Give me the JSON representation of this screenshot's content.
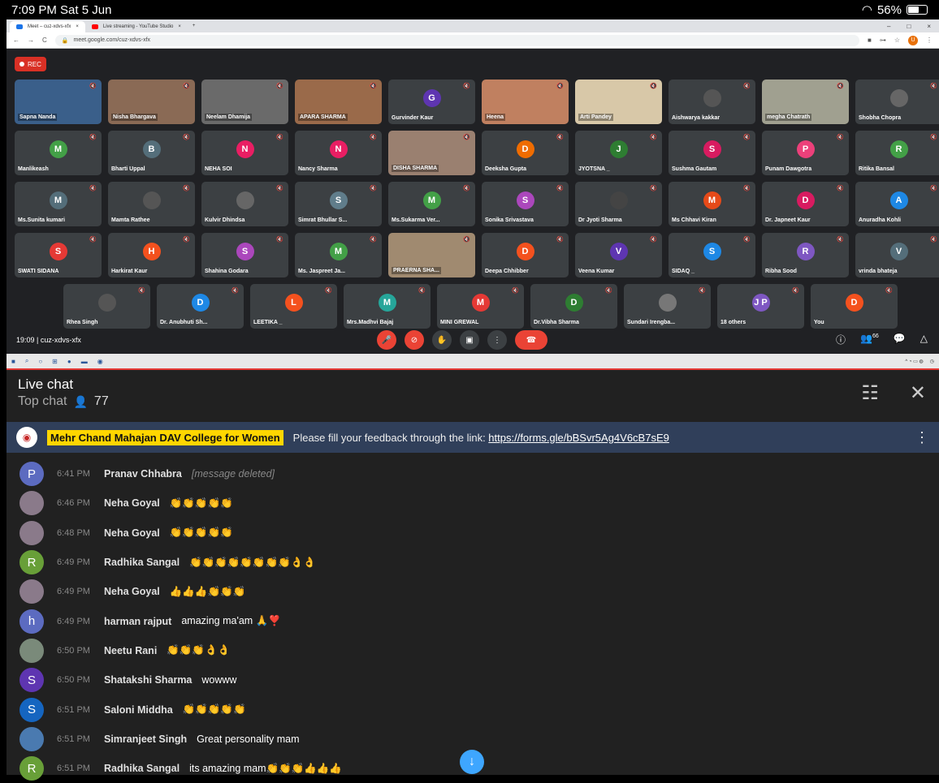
{
  "status": {
    "time": "7:09 PM  Sat 5 Jun",
    "battery": "56%",
    "battery_level": 0.56,
    "wifi_icon": "wifi-icon"
  },
  "browser": {
    "tabs": [
      {
        "label": "Meet – cuz-xdvs-xfx",
        "color": "#1a73e8"
      },
      {
        "label": "Live streaming - YouTube Studio",
        "color": "#ff0000"
      }
    ],
    "url": "meet.google.com/cuz-xdvs-xfx",
    "profile_initial": "U"
  },
  "meet": {
    "rec_label": "REC",
    "rows": [
      [
        {
          "name": "Sapna Nanda",
          "video": true,
          "bg": "#3a5f8a"
        },
        {
          "name": "Nisha Bhargava",
          "video": true,
          "bg": "#8a6a55"
        },
        {
          "name": "Neelam Dhamija",
          "video": true,
          "bg": "#6a6a6a"
        },
        {
          "name": "APARA SHARMA",
          "video": true,
          "bg": "#9a6a4a"
        },
        {
          "name": "Gurvinder Kaur",
          "initial": "G",
          "color": "#5e35b1"
        },
        {
          "name": "Heena",
          "video": true,
          "bg": "#c08060"
        },
        {
          "name": "Arti Pandey",
          "video": true,
          "bg": "#d8c8a8"
        },
        {
          "name": "Aishwarya kakkar",
          "initial": "",
          "color": "#555"
        },
        {
          "name": "megha Chatrath",
          "video": true,
          "bg": "#a0a090"
        },
        {
          "name": "Shobha Chopra",
          "initial": "",
          "color": "#666"
        }
      ],
      [
        {
          "name": "Manlikeash",
          "initial": "M",
          "color": "#43a047"
        },
        {
          "name": "Bharti Uppal",
          "initial": "B",
          "color": "#546e7a"
        },
        {
          "name": "NEHA SOI",
          "initial": "N",
          "color": "#e91e63"
        },
        {
          "name": "Nancy Sharma",
          "initial": "N",
          "color": "#e91e63"
        },
        {
          "name": "DISHA SHARMA",
          "video": true,
          "bg": "#9a8070"
        },
        {
          "name": "Deeksha Gupta",
          "initial": "D",
          "color": "#ef6c00"
        },
        {
          "name": "JYOTSNA _",
          "initial": "J",
          "color": "#2e7d32"
        },
        {
          "name": "Sushma Gautam",
          "initial": "S",
          "color": "#d81b60"
        },
        {
          "name": "Punam Dawgotra",
          "initial": "P",
          "color": "#ec407a"
        },
        {
          "name": "Ritika Bansal",
          "initial": "R",
          "color": "#43a047"
        }
      ],
      [
        {
          "name": "Ms.Sunita kumari",
          "initial": "M",
          "color": "#546e7a"
        },
        {
          "name": "Mamta Rathee",
          "initial": "",
          "color": "#555"
        },
        {
          "name": "Kulvir Dhindsa",
          "initial": "",
          "color": "#666"
        },
        {
          "name": "Simrat Bhullar S...",
          "initial": "S",
          "color": "#607d8b"
        },
        {
          "name": "Ms.Sukarma Ver...",
          "initial": "M",
          "color": "#43a047"
        },
        {
          "name": "Sonika Srivastava",
          "initial": "S",
          "color": "#ab47bc"
        },
        {
          "name": "Dr Jyoti Sharma",
          "initial": "",
          "color": "#444"
        },
        {
          "name": "Ms Chhavi Kiran",
          "initial": "M",
          "color": "#e64a19"
        },
        {
          "name": "Dr. Japneet Kaur",
          "initial": "D",
          "color": "#d81b60"
        },
        {
          "name": "Anuradha Kohli",
          "initial": "A",
          "color": "#1e88e5"
        }
      ],
      [
        {
          "name": "SWATI SIDANA",
          "initial": "S",
          "color": "#e53935"
        },
        {
          "name": "Harkirat Kaur",
          "initial": "H",
          "color": "#f4511e"
        },
        {
          "name": "Shahina Godara",
          "initial": "S",
          "color": "#ab47bc"
        },
        {
          "name": "Ms. Jaspreet Ja...",
          "initial": "M",
          "color": "#43a047"
        },
        {
          "name": "PRAERNA SHA...",
          "video": true,
          "bg": "#a08a70"
        },
        {
          "name": "Deepa Chhibber",
          "initial": "D",
          "color": "#f4511e"
        },
        {
          "name": "Veena Kumar",
          "initial": "V",
          "color": "#5e35b1"
        },
        {
          "name": "SIDAQ _",
          "initial": "S",
          "color": "#1e88e5"
        },
        {
          "name": "Ribha Sood",
          "initial": "R",
          "color": "#7e57c2"
        },
        {
          "name": "vrinda bhateja",
          "initial": "V",
          "color": "#546e7a"
        }
      ],
      [
        {
          "name": "Rhea Singh",
          "initial": "",
          "color": "#555"
        },
        {
          "name": "Dr. Anubhuti Sh...",
          "initial": "D",
          "color": "#1e88e5"
        },
        {
          "name": "LEETIKA _",
          "initial": "L",
          "color": "#f4511e"
        },
        {
          "name": "Mrs.Madhvi Bajaj",
          "initial": "M",
          "color": "#26a69a"
        },
        {
          "name": "MINI GREWAL",
          "initial": "M",
          "color": "#e53935"
        },
        {
          "name": "Dr.Vibha Sharma",
          "initial": "D",
          "color": "#2e7d32"
        },
        {
          "name": "Sundari Irengba...",
          "initial": "",
          "color": "#777"
        },
        {
          "name": "18 others",
          "initial": "J P",
          "color": "#7e57c2"
        },
        {
          "name": "You",
          "initial": "D",
          "color": "#f4511e"
        }
      ]
    ],
    "meeting_label": "19:09  |  cuz-xdvs-xfx",
    "participant_count": "66"
  },
  "chat": {
    "title": "Live chat",
    "subtitle": "Top chat",
    "viewers": "77",
    "pinned": {
      "author": "Mehr Chand Mahajan DAV College for Women",
      "text": "Please fill your feedback through the link: ",
      "link": "https://forms.gle/bBSvr5Ag4V6cB7sE9"
    },
    "messages": [
      {
        "initial": "P",
        "color": "#5c6bc0",
        "time": "6:41 PM",
        "author": "Pranav Chhabra",
        "text": "[message deleted]",
        "deleted": true
      },
      {
        "initial": "",
        "color": "#8a7a8a",
        "time": "6:46 PM",
        "author": "Neha Goyal",
        "text": "👏👏👏👏👏"
      },
      {
        "initial": "",
        "color": "#8a7a8a",
        "time": "6:48 PM",
        "author": "Neha Goyal",
        "text": "👏👏👏👏👏"
      },
      {
        "initial": "R",
        "color": "#689f38",
        "time": "6:49 PM",
        "author": "Radhika Sangal",
        "text": "👏👏👏👏👏👏👏👏👌👌"
      },
      {
        "initial": "",
        "color": "#8a7a8a",
        "time": "6:49 PM",
        "author": "Neha Goyal",
        "text": "👍👍👍👏👏👏"
      },
      {
        "initial": "h",
        "color": "#5c6bc0",
        "time": "6:49 PM",
        "author": "harman rajput",
        "text": "amazing ma'am 🙏❣️"
      },
      {
        "initial": "",
        "color": "#7a8a7a",
        "time": "6:50 PM",
        "author": "Neetu Rani",
        "text": "👏👏👏👌👌"
      },
      {
        "initial": "S",
        "color": "#5e35b1",
        "time": "6:50 PM",
        "author": "Shatakshi Sharma",
        "text": "wowww"
      },
      {
        "initial": "S",
        "color": "#1565c0",
        "time": "6:51 PM",
        "author": "Saloni Middha",
        "text": "👏👏👏👏👏"
      },
      {
        "initial": "",
        "color": "#4a7ab0",
        "time": "6:51 PM",
        "author": "Simranjeet Singh",
        "text": "Great personality mam"
      },
      {
        "initial": "R",
        "color": "#689f38",
        "time": "6:51 PM",
        "author": "Radhika Sangal",
        "text": "its amazing mam👏👏👏👍👍👍"
      }
    ]
  }
}
